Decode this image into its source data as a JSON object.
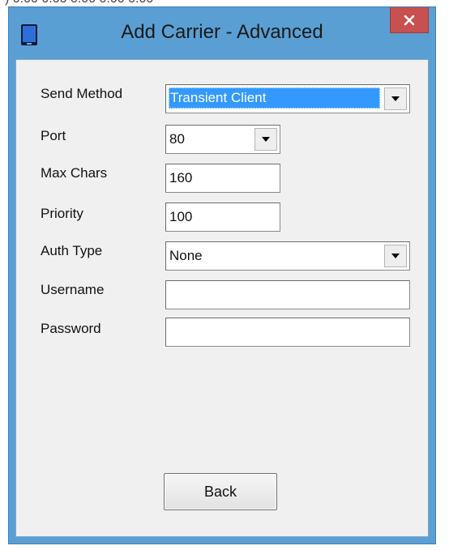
{
  "window": {
    "title": "Add Carrier - Advanced",
    "close_glyph": "✕"
  },
  "form": {
    "send_method": {
      "label": "Send Method",
      "value": "Transient Client"
    },
    "port": {
      "label": "Port",
      "value": "80"
    },
    "max_chars": {
      "label": "Max Chars",
      "value": "160"
    },
    "priority": {
      "label": "Priority",
      "value": "100"
    },
    "auth_type": {
      "label": "Auth Type",
      "value": "None"
    },
    "username": {
      "label": "Username",
      "value": ""
    },
    "password": {
      "label": "Password",
      "value": ""
    }
  },
  "buttons": {
    "back": "Back"
  },
  "colors": {
    "title_bar": "#5a9fd4",
    "close_button": "#c75050",
    "client_area": "#f0f0f0",
    "selection": "#3399ff"
  },
  "icons": {
    "app": "phone-icon",
    "dropdown": "chevron-down-icon"
  }
}
